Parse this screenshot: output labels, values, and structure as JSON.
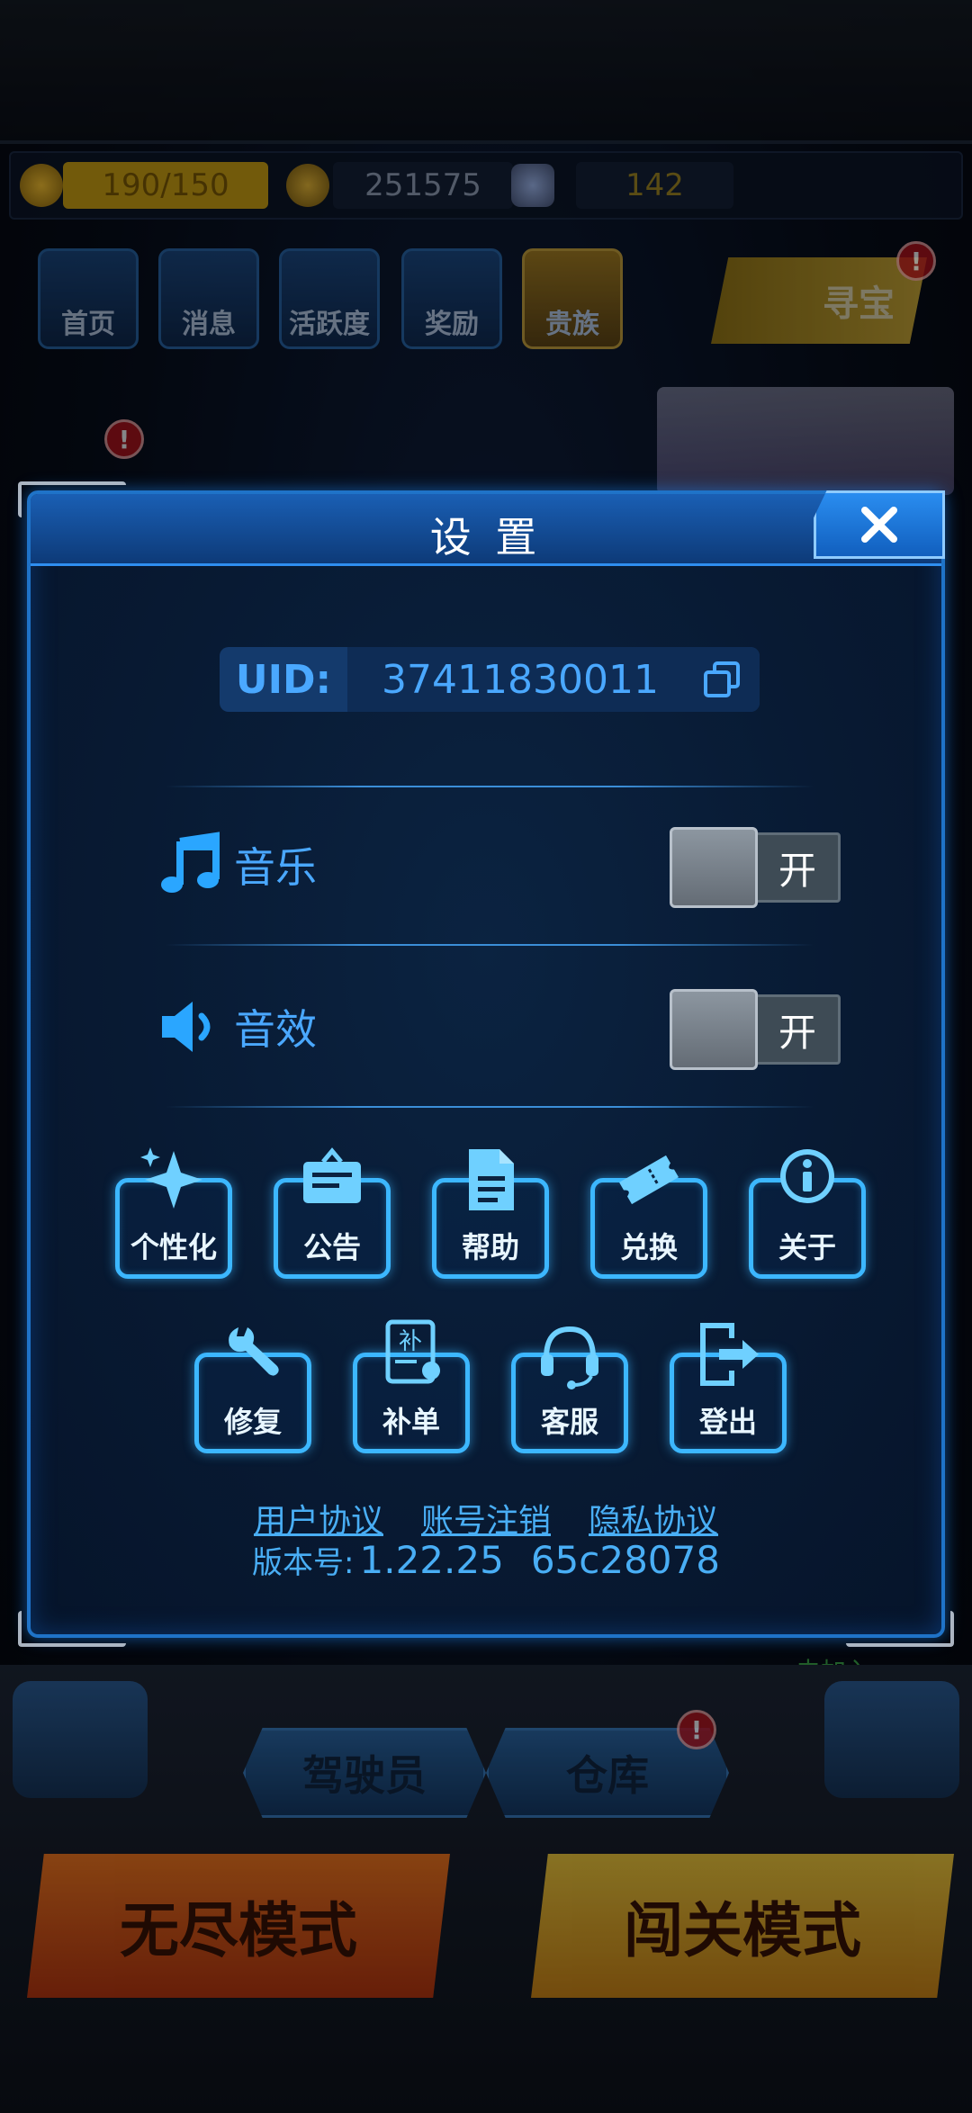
{
  "resources": {
    "energy": "190/150",
    "gold": "251575",
    "gems": "142"
  },
  "top_nav": [
    {
      "label": "首页"
    },
    {
      "label": "消息"
    },
    {
      "label": "活跃度"
    },
    {
      "label": "奖励"
    },
    {
      "label": "贵族"
    }
  ],
  "treasure": {
    "label": "寻宝",
    "badge": "!"
  },
  "background": {
    "unjoined_text": "未加入",
    "pilot_label": "驾驶员",
    "warehouse_label": "仓库",
    "warehouse_badge": "!",
    "endless_mode": "无尽模式",
    "stage_mode": "闯关模式"
  },
  "dialog": {
    "title": "设 置",
    "close_icon": "close-icon",
    "uid_label": "UID:",
    "uid_value": "37411830011",
    "settings": [
      {
        "icon": "music-note-icon",
        "label": "音乐",
        "toggle_text": "开"
      },
      {
        "icon": "speaker-icon",
        "label": "音效",
        "toggle_text": "开"
      }
    ],
    "functions_row1": [
      {
        "icon": "sparkle-icon",
        "label": "个性化"
      },
      {
        "icon": "notice-board-icon",
        "label": "公告"
      },
      {
        "icon": "document-icon",
        "label": "帮助"
      },
      {
        "icon": "ticket-icon",
        "label": "兑换"
      },
      {
        "icon": "info-icon",
        "label": "关于"
      }
    ],
    "functions_row2": [
      {
        "icon": "wrench-icon",
        "label": "修复"
      },
      {
        "icon": "supplement-order-icon",
        "label": "补单"
      },
      {
        "icon": "headset-icon",
        "label": "客服"
      },
      {
        "icon": "logout-icon",
        "label": "登出"
      }
    ],
    "links": [
      "用户协议",
      "账号注销",
      "隐私协议"
    ],
    "version_label": "版本号:",
    "version_number": "1.22.25",
    "version_hash": "65c28078"
  },
  "colors": {
    "accent": "#3cb7ff",
    "text_blue": "#4aa8ff",
    "dialog_bg": "#081a33",
    "header": "#1a5fb4"
  }
}
